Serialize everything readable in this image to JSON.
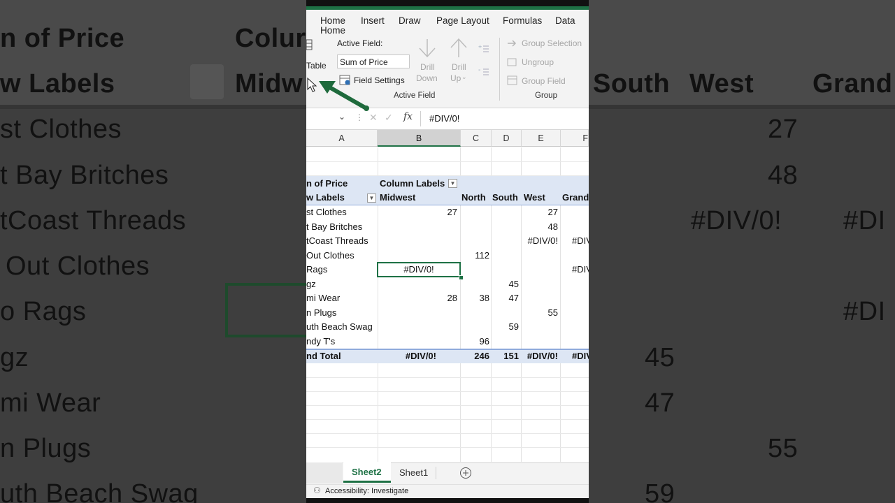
{
  "background": {
    "texts": [
      "n of Price",
      "Colur",
      "w Labels",
      "Midw",
      "South",
      "West",
      "Grand",
      "st Clothes",
      "27",
      "t Bay Britches",
      "48",
      "tCoast  Threads",
      "#DIV/0!",
      "#DIV/0!",
      "#DI",
      "Out Clothes",
      "o Rags",
      "#DI",
      "gz",
      "45",
      "mi Wear",
      "47",
      "n Plugs",
      "55",
      "uth Beach Swag",
      "59"
    ]
  },
  "ribbon": {
    "tabs": [
      "Home",
      "Insert",
      "Draw",
      "Page Layout",
      "Formulas",
      "Data"
    ],
    "pivot_table_label": "Table",
    "active_field_label": "Active Field:",
    "active_field_value": "Sum of Price",
    "field_settings": "Field Settings",
    "drill_down_1": "Drill",
    "drill_down_2": "Down",
    "drill_up_1": "Drill",
    "drill_up_2": "Up",
    "active_field_group": "Active Field",
    "group_selection": "Group Selection",
    "ungroup": "Ungroup",
    "group_field": "Group Field",
    "group_group": "Group"
  },
  "formula_bar": {
    "fx": "fx",
    "value": "#DIV/0!"
  },
  "columns": [
    "A",
    "B",
    "C",
    "D",
    "E",
    "F"
  ],
  "pivot": {
    "sum_label": "n of Price",
    "column_labels": "Column Labels",
    "row_labels": "w Labels",
    "headers": [
      "Midwest",
      "North",
      "South",
      "West",
      "Grand"
    ],
    "rows": [
      {
        "label": "st Clothes",
        "b": "27",
        "c": "",
        "d": "",
        "e": "27",
        "f": ""
      },
      {
        "label": "t Bay Britches",
        "b": "",
        "c": "",
        "d": "",
        "e": "48",
        "f": ""
      },
      {
        "label": "tCoast  Threads",
        "b": "",
        "c": "",
        "d": "",
        "e": "#DIV/0!",
        "f": "#DIV"
      },
      {
        "label": "Out Clothes",
        "b": "",
        "c": "112",
        "d": "",
        "e": "",
        "f": ""
      },
      {
        "label": "Rags",
        "b": "#DIV/0!",
        "c": "",
        "d": "",
        "e": "",
        "f": "#DIV"
      },
      {
        "label": "gz",
        "b": "",
        "c": "",
        "d": "45",
        "e": "",
        "f": ""
      },
      {
        "label": "mi Wear",
        "b": "28",
        "c": "38",
        "d": "47",
        "e": "",
        "f": ""
      },
      {
        "label": "n Plugs",
        "b": "",
        "c": "",
        "d": "",
        "e": "55",
        "f": ""
      },
      {
        "label": "uth Beach Swag",
        "b": "",
        "c": "",
        "d": "59",
        "e": "",
        "f": ""
      },
      {
        "label": "ndy T's",
        "b": "",
        "c": "96",
        "d": "",
        "e": "",
        "f": ""
      }
    ],
    "grand_total": {
      "label": "nd Total",
      "b": "#DIV/0!",
      "c": "246",
      "d": "151",
      "e": "#DIV/0!",
      "f": "#DIV"
    }
  },
  "sheets": [
    "Sheet2",
    "Sheet1"
  ],
  "status": "Accessibility: Investigate",
  "colors": {
    "accent": "#1e7145",
    "pivot_header": "#dde6f4"
  }
}
